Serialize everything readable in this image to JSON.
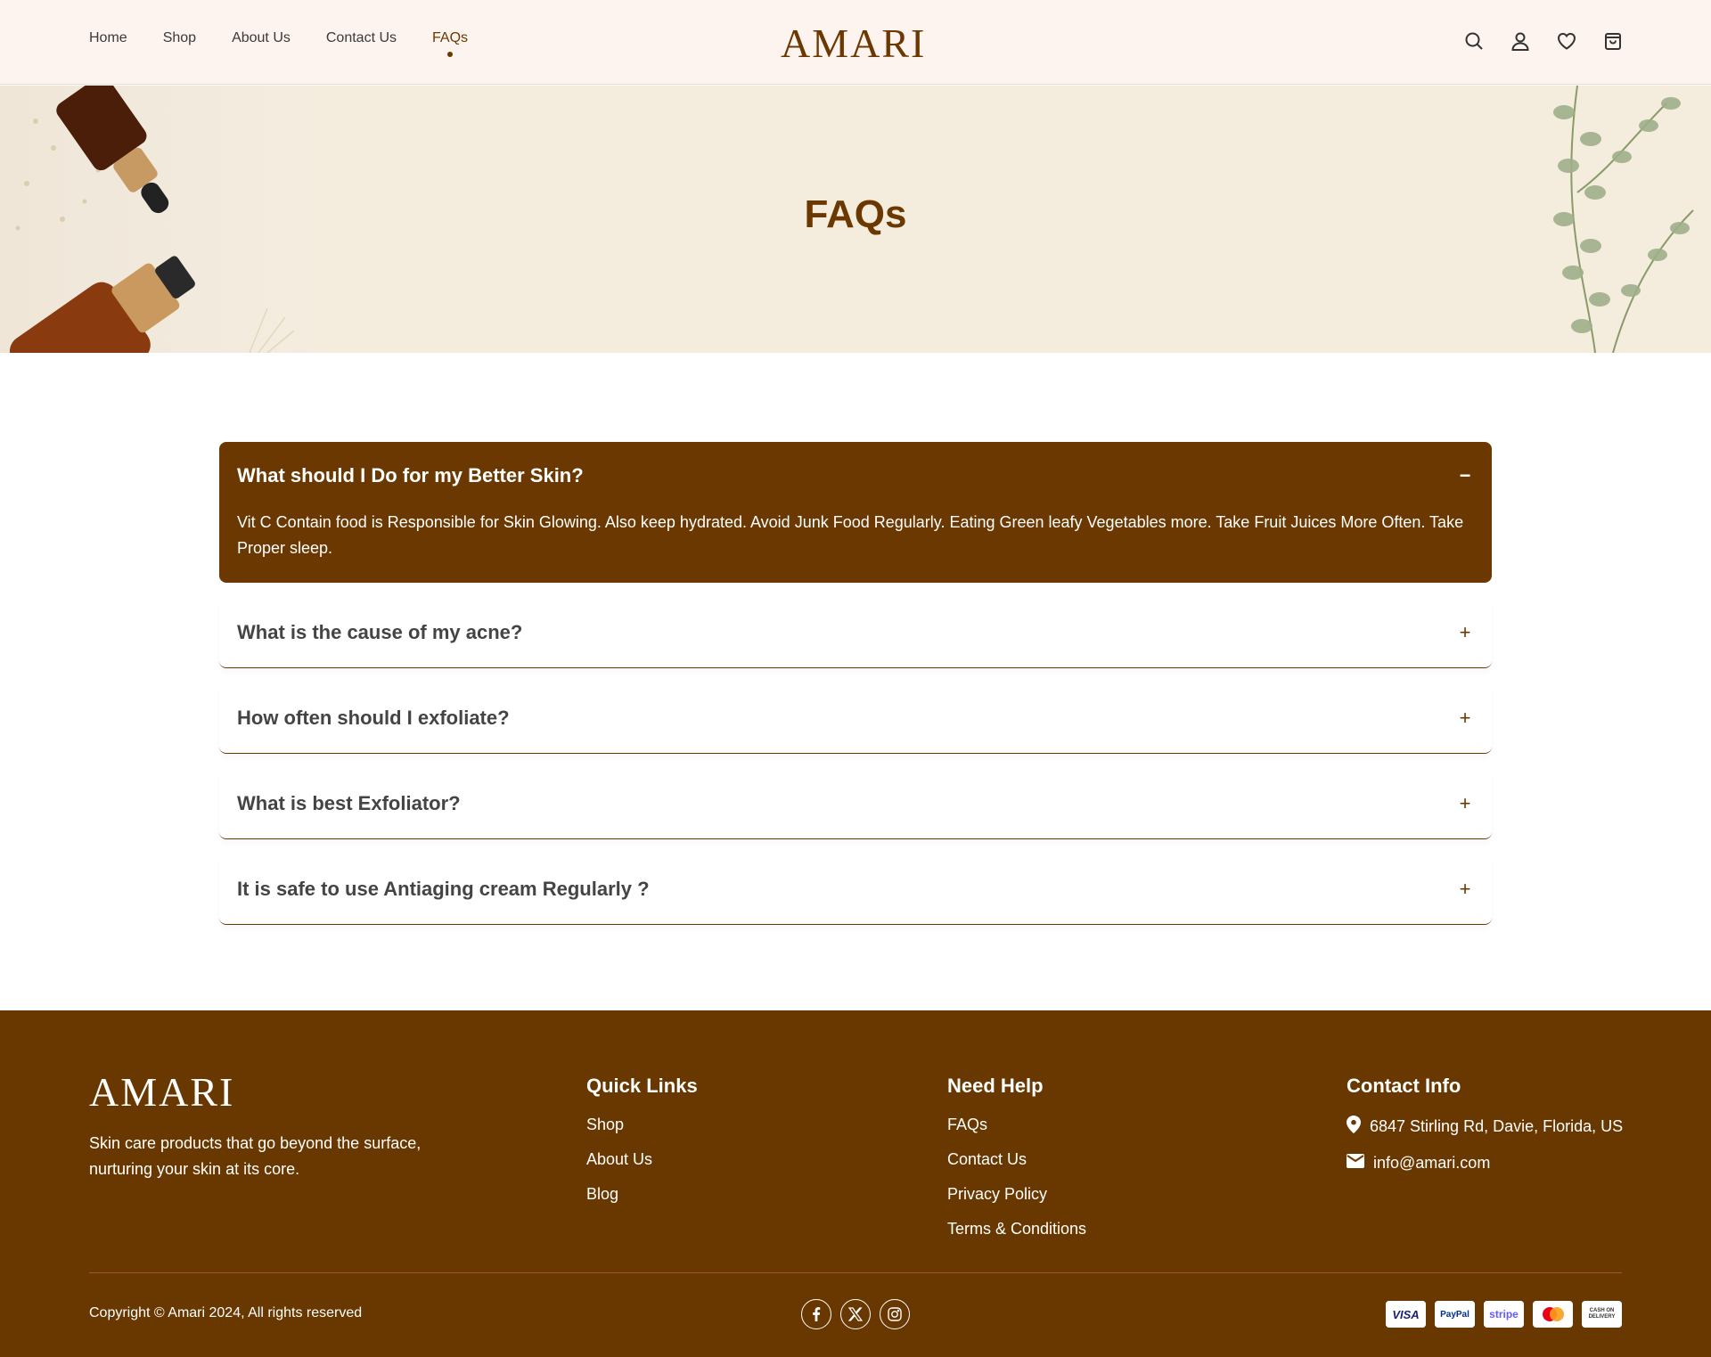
{
  "brand": {
    "name": "AMARI",
    "accent": "#6a3800",
    "footer_bg": "#693800",
    "header_bg": "#fdf3ef",
    "hero_bg": "#f4ecdc"
  },
  "nav": {
    "items": [
      {
        "label": "Home"
      },
      {
        "label": "Shop"
      },
      {
        "label": "About Us"
      },
      {
        "label": "Contact Us"
      },
      {
        "label": "FAQs",
        "active": true
      }
    ]
  },
  "header_icons": [
    "search-icon",
    "user-icon",
    "heart-icon",
    "shopping-bag-icon"
  ],
  "hero": {
    "title": "FAQs"
  },
  "faq": {
    "open": {
      "question": "What should I Do for my Better Skin?",
      "answer": "Vit C Contain food is Responsible for Skin Glowing. Also keep hydrated. Avoid Junk Food Regularly. Eating Green leafy Vegetables more. Take Fruit Juices More Often. Take Proper sleep.",
      "toggle": "−"
    },
    "items": [
      {
        "question": "What is the cause of my acne?",
        "toggle": "+"
      },
      {
        "question": "How often should I exfoliate?",
        "toggle": "+"
      },
      {
        "question": "What is best Exfoliator?",
        "toggle": "+"
      },
      {
        "question": "It is safe to use Antiaging cream Regularly ?",
        "toggle": "+"
      }
    ]
  },
  "footer": {
    "logo": "AMARI",
    "description": "Skin care products that go beyond the surface, nurturing your skin at its core.",
    "quick_links": {
      "title": "Quick Links",
      "links": [
        "Shop",
        "About Us",
        "Blog"
      ]
    },
    "need_help": {
      "title": "Need Help",
      "links": [
        "FAQs",
        "Contact Us",
        "Privacy Policy",
        "Terms & Conditions"
      ]
    },
    "contact": {
      "title": "Contact Info",
      "address": "6847 Stirling Rd, Davie, Florida, US",
      "email": "info@amari.com"
    },
    "copyright": "Copyright © Amari 2024, All rights reserved",
    "socials": [
      "facebook-icon",
      "x-icon",
      "instagram-icon"
    ],
    "payments": [
      {
        "name": "visa",
        "label": "VISA",
        "color": "#1a1f71"
      },
      {
        "name": "paypal",
        "label": "PayPal",
        "color": "#003087"
      },
      {
        "name": "stripe",
        "label": "stripe",
        "color": "#635bff"
      },
      {
        "name": "mastercard",
        "label": "",
        "color": "#eb001b"
      },
      {
        "name": "cash-on-delivery",
        "label": "CASH ON DELIVERY",
        "color": "#333333"
      }
    ]
  }
}
